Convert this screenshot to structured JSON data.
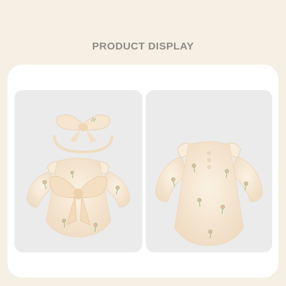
{
  "header": {
    "title": "PRODUCT DISPLAY"
  },
  "gallery": {
    "images": [
      {
        "view": "front",
        "item": "romper-with-bow-and-headband"
      },
      {
        "view": "back",
        "item": "romper-back"
      }
    ]
  },
  "colors": {
    "page_bg": "#f6f0e4",
    "card_bg": "#ffffff",
    "tile_bg": "#ebebeb",
    "title_text": "#8f8a86",
    "fabric": "#f7e8d3",
    "fabric_shade": "#eed9bd",
    "flower": "#f1b7a4",
    "stem": "#9cc08a"
  }
}
